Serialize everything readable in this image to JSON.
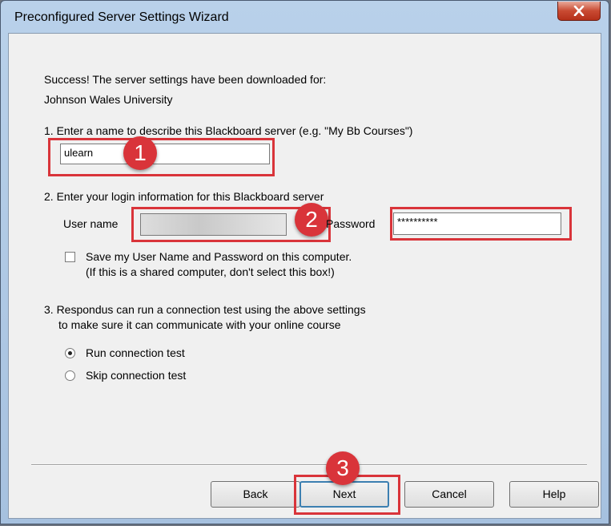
{
  "window": {
    "title": "Preconfigured Server Settings Wizard"
  },
  "success": {
    "line1": "Success! The server settings have been downloaded for:",
    "line2": "Johnson  Wales University"
  },
  "step1": {
    "label": "1.  Enter a name to describe this Blackboard server (e.g. \"My Bb Courses\")",
    "server_name_value": "ulearn"
  },
  "step2": {
    "label": "2.  Enter your login information for this Blackboard server",
    "username_label": "User name",
    "password_label": "Password",
    "password_value": "**********",
    "save_checkbox_label": "Save my User Name and Password on this computer.",
    "save_checkbox_hint": "(If this is a shared computer, don't select this box!)",
    "save_checked": false
  },
  "step3": {
    "label_line1": "3.  Respondus can run a connection test using the above settings",
    "label_line2": "to make sure it can communicate with your online course",
    "options": [
      {
        "label": "Run connection test",
        "selected": true
      },
      {
        "label": "Skip connection test",
        "selected": false
      }
    ]
  },
  "callouts": [
    "1",
    "2",
    "3"
  ],
  "buttons": {
    "back": "Back",
    "next": "Next",
    "cancel": "Cancel",
    "help": "Help"
  },
  "colors": {
    "highlight": "#d9343a",
    "title_bar": "#b9d1ea",
    "close_button": "#c94a32"
  }
}
